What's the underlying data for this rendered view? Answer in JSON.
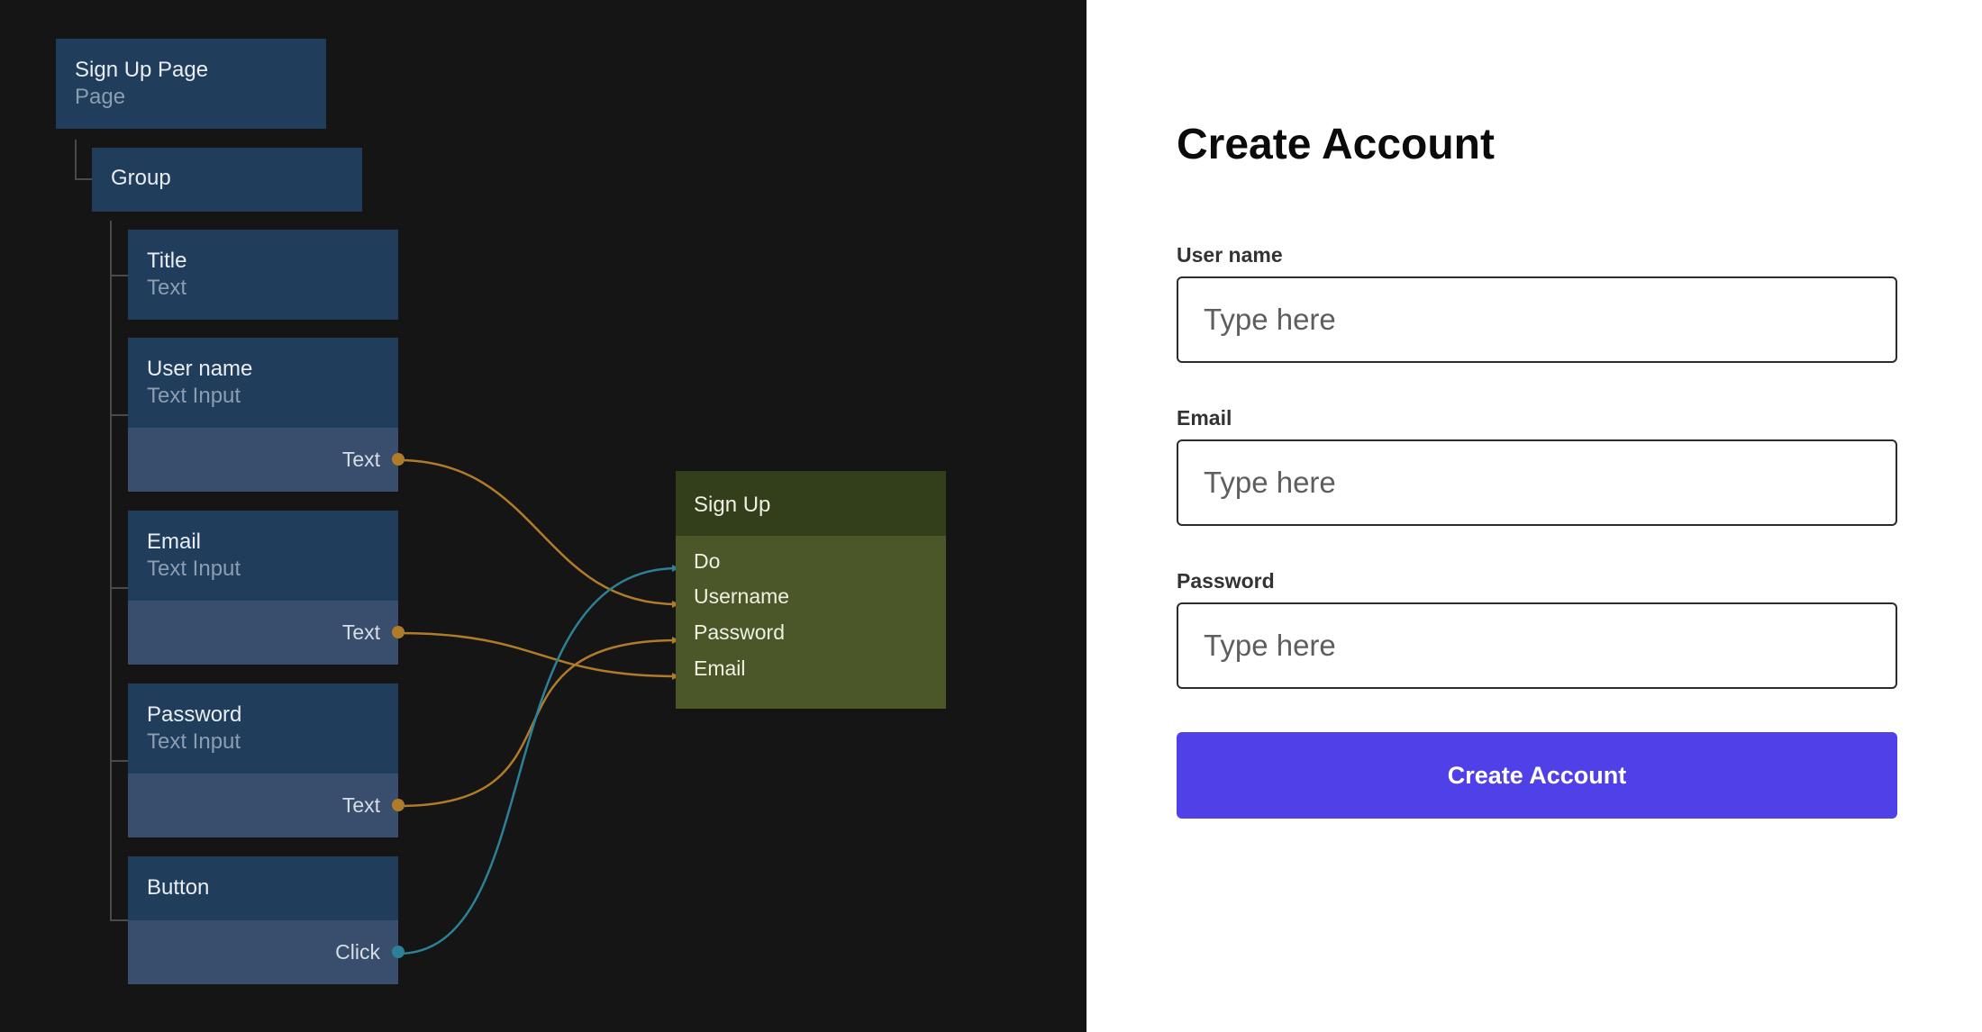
{
  "graph": {
    "page_node": {
      "title": "Sign Up Page",
      "type": "Page"
    },
    "group_node": {
      "title": "Group"
    },
    "title_node": {
      "title": "Title",
      "type": "Text"
    },
    "username_node": {
      "title": "User name",
      "type": "Text Input",
      "port": "Text"
    },
    "email_node": {
      "title": "Email",
      "type": "Text Input",
      "port": "Text"
    },
    "password_node": {
      "title": "Password",
      "type": "Text Input",
      "port": "Text"
    },
    "button_node": {
      "title": "Button",
      "port": "Click"
    },
    "signup_node": {
      "title": "Sign Up",
      "inputs": [
        "Do",
        "Username",
        "Password",
        "Email"
      ]
    },
    "colors": {
      "text_wire": "#b07c2a",
      "signal_wire": "#2d8197"
    }
  },
  "form": {
    "title": "Create Account",
    "fields": [
      {
        "label": "User name",
        "placeholder": "Type here"
      },
      {
        "label": "Email",
        "placeholder": "Type here"
      },
      {
        "label": "Password",
        "placeholder": "Type here"
      }
    ],
    "button_label": "Create Account",
    "button_color": "#4f40e8"
  }
}
